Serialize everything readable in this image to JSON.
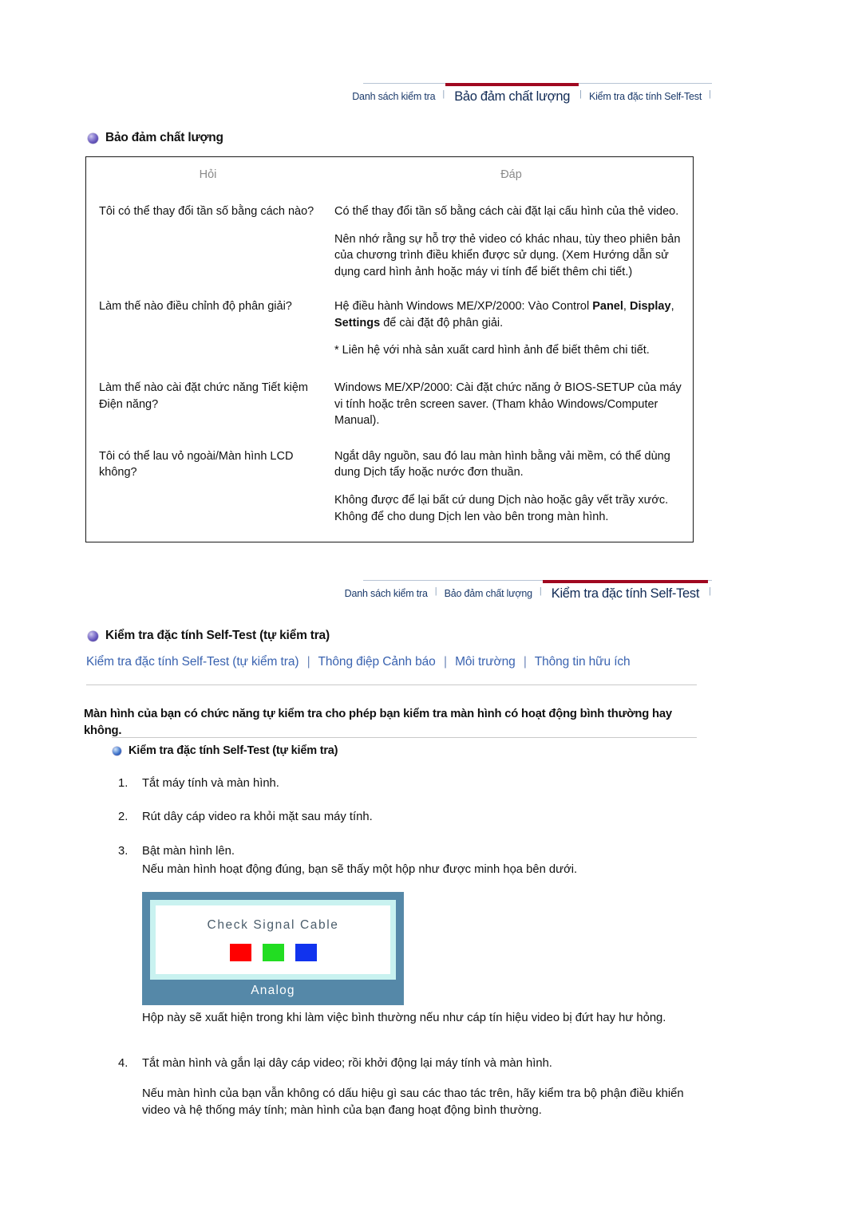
{
  "nav_top": {
    "tabs": [
      {
        "label": "Danh sách kiểm tra",
        "active": false
      },
      {
        "label": "Bảo đảm chất lượng",
        "active": true
      },
      {
        "label": "Kiểm tra đặc tính Self-Test",
        "active": false
      }
    ],
    "separator": "|",
    "accent_color": "#a00820",
    "link_color": "#1b3a6b"
  },
  "nav_bottom": {
    "tabs": [
      {
        "label": "Danh sách kiểm tra",
        "active": false
      },
      {
        "label": "Bảo đảm chất lượng",
        "active": false
      },
      {
        "label": "Kiểm tra đặc tính Self-Test",
        "active": true
      }
    ],
    "separator": "|",
    "accent_color": "#a00820"
  },
  "section1": {
    "title": "Bảo đảm chất lượng",
    "table": {
      "headers": {
        "question": "Hỏi",
        "answer": "Đáp"
      },
      "rows": [
        {
          "question": "Tôi có thể thay đổi tần số bằng cách nào?",
          "answer_1": "Có thể thay đổi tần số bằng cách cài đặt lại cấu hình của thẻ video.",
          "answer_2": "Nên nhớ rằng sự hỗ trợ thẻ video có khác nhau, tùy theo phiên bản của chương trình điều khiển được sử dụng. (Xem Hướng dẫn sử dụng card hình ảnh hoặc máy vi tính để biết thêm chi tiết.)"
        },
        {
          "question": "Làm thế nào điều chỉnh độ phân giải?",
          "answer_1_pre": "Hệ điều hành Windows ME/XP/2000: Vào Control ",
          "answer_1_b1": "Panel",
          "answer_1_mid1": ", ",
          "answer_1_b2": "Display",
          "answer_1_mid2": ", ",
          "answer_1_b3": "Settings",
          "answer_1_post": " để cài đặt độ phân giải.",
          "answer_2": "* Liên hệ với nhà sản xuất card hình ảnh để biết thêm chi tiết."
        },
        {
          "question": "Làm thế nào cài đặt chức năng Tiết kiệm Điện năng?",
          "answer_1": "Windows ME/XP/2000: Cài đặt chức năng ở BIOS-SETUP của máy vi tính hoặc trên screen saver. (Tham khảo Windows/Computer Manual)."
        },
        {
          "question": "Tôi có thể lau vỏ ngoài/Màn hình LCD không?",
          "answer_1": "Ngắt dây nguồn, sau đó lau màn hình bằng vải mềm, có thể dùng dung Dịch tẩy hoặc nước đơn thuần.",
          "answer_2": "Không được để lại bất cứ dung Dịch nào hoặc gây vết trầy xước. Không để cho dung Dịch len vào bên trong màn hình."
        }
      ]
    }
  },
  "section2": {
    "title": "Kiểm tra đặc tính Self-Test (tự kiểm tra)",
    "subnav": [
      "Kiểm tra đặc tính Self-Test (tự kiểm tra)",
      "Thông điệp Cảnh báo",
      "Môi trường",
      "Thông tin hữu ích"
    ],
    "subnav_separator": "|",
    "intro": "Màn hình của bạn có chức năng tự kiểm tra cho phép bạn kiểm tra màn hình có hoạt động bình thường hay không.",
    "subheading": "Kiểm tra đặc tính Self-Test (tự kiểm tra)",
    "steps": [
      {
        "num": "1.",
        "text": "Tắt máy tính và màn hình."
      },
      {
        "num": "2.",
        "text": "Rút dây cáp video ra khỏi mặt sau máy tính."
      },
      {
        "num": "3.",
        "text": "Bật màn hình lên."
      }
    ],
    "note_after_step3": "Nếu màn hình hoạt động đúng, bạn sẽ thấy một hộp như được minh họa bên dưới.",
    "self_test_image": {
      "message": "Check Signal Cable",
      "label": "Analog",
      "swatch_colors": [
        "#ff0000",
        "#22dd22",
        "#1133ee"
      ],
      "frame_color": "#5588a8",
      "inner_border_color": "#c9f2f0",
      "message_color": "#4b5d6b"
    },
    "note_after_image": "Hộp này sẽ xuất hiện trong khi làm việc bình thường nếu như cáp tín hiệu video bị đứt hay hư hỏng.",
    "step4": {
      "num": "4.",
      "text": "Tắt màn hình và gắn lại dây cáp video; rồi khởi động lại máy tính và màn hình."
    },
    "closing": "Nếu màn hình của bạn vẫn không có dấu hiệu gì sau các thao tác trên, hãy kiểm tra bộ phận điều khiển video và hệ thống máy tính; màn hình của bạn đang hoạt động bình thường."
  }
}
